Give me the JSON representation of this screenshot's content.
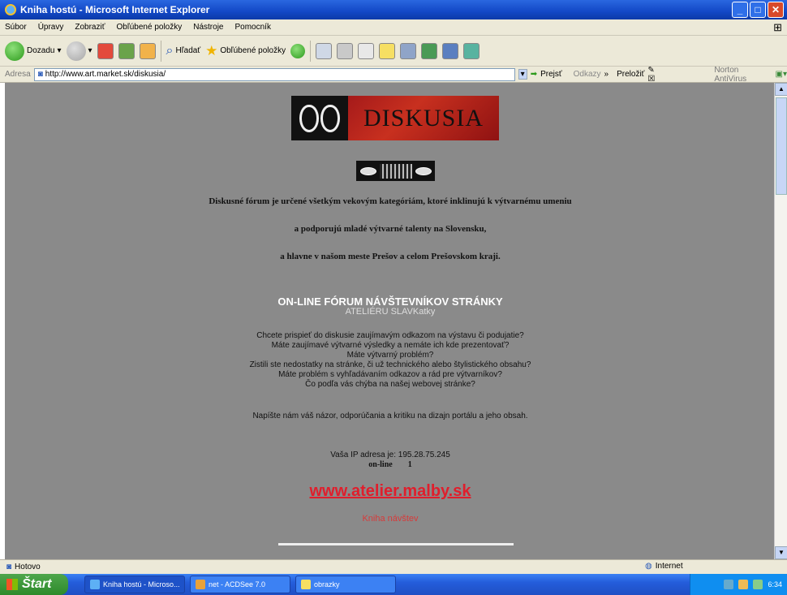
{
  "window": {
    "title": "Kniha hostú - Microsoft Internet Explorer"
  },
  "menu": [
    "Súbor",
    "Úpravy",
    "Zobraziť",
    "Obľúbené položky",
    "Nástroje",
    "Pomocník"
  ],
  "toolbar": {
    "back": "Dozadu",
    "search": "Hľadať",
    "favorites": "Obľúbené položky"
  },
  "address": {
    "label": "Adresa",
    "url": "http://www.art.market.sk/diskusia/",
    "go": "Prejsť",
    "links": "Odkazy",
    "translate": "Preložiť",
    "norton": "Norton AntiVirus"
  },
  "page": {
    "logo_text": "DISKUSIA",
    "intro_lines": [
      "Diskusné fórum je určené všetkým vekovým kategóriám, ktoré inklinujú k výtvarnému umeniu",
      "a podporujú mladé výtvarné talenty na Slovensku,",
      "a hlavne v našom meste Prešov a celom Prešovskom kraji."
    ],
    "forum_heading": "ON-LINE FÓRUM NÁVŠTEVNÍKOV STRÁNKY",
    "forum_sub": "ATELIÉRU SLAVKatky",
    "questions": [
      "Chcete prispieť do diskusie zaujímavým odkazom na výstavu či podujatie?",
      "Máte zaujímavé výtvarné výsledky a nemáte ich kde prezentovať?",
      "Máte výtvarný problém?",
      "Zistili ste nedostatky na stránke, či už technického alebo štylistického obsahu?",
      "Máte problém s vyhľadávaním odkazov a rád pre výtvarníkov?",
      "Čo podľa vás chýba na našej webovej stránke?"
    ],
    "cta": "Napíšte nám váš názor, odporúčania a kritiku na dizajn portálu a jeho obsah.",
    "ip_text": "Vaša IP adresa je: 195.28.75.245",
    "online_label": "on-line",
    "online_count": "1",
    "site_link": "www.atelier.malby.sk",
    "guestbook_link": "Kniha návštev"
  },
  "status": {
    "left": "Hotovo",
    "zone": "Internet"
  },
  "taskbar": {
    "start": "Štart",
    "tasks": [
      "Kniha hostú - Microso...",
      "net - ACDSee 7.0",
      "obrazky"
    ],
    "time": "6:34"
  }
}
